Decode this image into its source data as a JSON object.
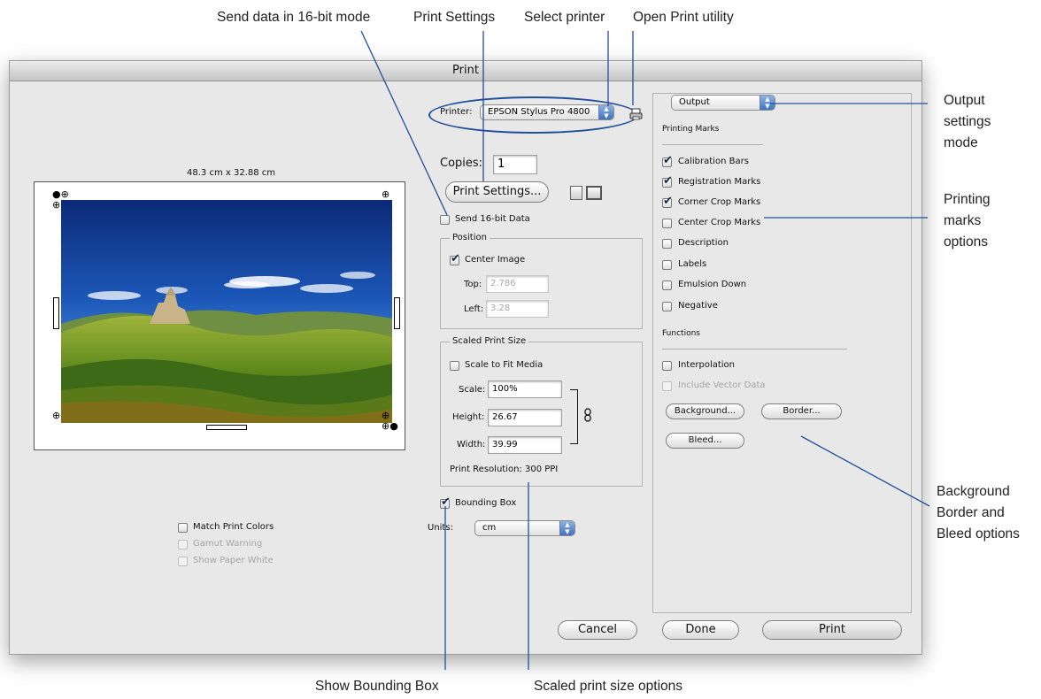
{
  "annotations": {
    "send_16bit": "Send data in 16-bit mode",
    "print_settings": "Print Settings",
    "select_printer": "Select printer",
    "open_print_utility": "Open Print utility",
    "output_settings_mode": [
      "Output",
      "settings",
      "mode"
    ],
    "printing_marks_options": [
      "Printing",
      "marks",
      "options"
    ],
    "background_border_bleed": [
      "Background",
      "Border and",
      "Bleed options"
    ],
    "show_bounding_box": "Show Bounding Box",
    "scaled_print_size_options": "Scaled print size options"
  },
  "dialog": {
    "title": "Print",
    "left": {
      "paper_size": "48.3 cm x 32.88 cm",
      "match_print_colors": {
        "label": "Match Print Colors",
        "checked": false
      },
      "gamut_warning": {
        "label": "Gamut Warning",
        "checked": false,
        "disabled": true
      },
      "show_paper_white": {
        "label": "Show Paper White",
        "checked": false,
        "disabled": true
      }
    },
    "middle": {
      "printer_label": "Printer:",
      "printer_value": "EPSON Stylus Pro 4800",
      "copies_label": "Copies:",
      "copies_value": "1",
      "print_settings_button": "Print Settings...",
      "send_16bit": {
        "label": "Send 16-bit Data",
        "checked": false
      },
      "position": {
        "title": "Position",
        "center_image": {
          "label": "Center Image",
          "checked": true
        },
        "top_label": "Top:",
        "top_value": "2.786",
        "left_label": "Left:",
        "left_value": "3.28"
      },
      "scaled": {
        "title": "Scaled Print Size",
        "scale_to_fit": {
          "label": "Scale to Fit Media",
          "checked": false
        },
        "scale_label": "Scale:",
        "scale_value": "100%",
        "height_label": "Height:",
        "height_value": "26.67",
        "width_label": "Width:",
        "width_value": "39.99",
        "resolution": "Print Resolution: 300 PPI"
      },
      "bounding_box": {
        "label": "Bounding Box",
        "checked": true
      },
      "units_label": "Units:",
      "units_value": "cm"
    },
    "right": {
      "mode_value": "Output",
      "printing_marks_title": "Printing Marks",
      "marks": [
        {
          "label": "Calibration Bars",
          "checked": true,
          "disabled": false
        },
        {
          "label": "Registration Marks",
          "checked": true,
          "disabled": false
        },
        {
          "label": "Corner Crop Marks",
          "checked": true,
          "disabled": false
        },
        {
          "label": "Center Crop Marks",
          "checked": false,
          "disabled": false
        },
        {
          "label": "Description",
          "checked": false,
          "disabled": false
        },
        {
          "label": "Labels",
          "checked": false,
          "disabled": false
        },
        {
          "label": "Emulsion Down",
          "checked": false,
          "disabled": false
        },
        {
          "label": "Negative",
          "checked": false,
          "disabled": false
        }
      ],
      "functions_title": "Functions",
      "interpolation": {
        "label": "Interpolation",
        "checked": false
      },
      "include_vector": {
        "label": "Include Vector Data",
        "checked": false,
        "disabled": true
      },
      "background_button": "Background...",
      "border_button": "Border...",
      "bleed_button": "Bleed..."
    },
    "buttons": {
      "cancel": "Cancel",
      "done": "Done",
      "print": "Print"
    }
  },
  "colors": {
    "callout_line": "#1f4f9a",
    "printer_highlight": "#1f4f9a"
  },
  "icons": [
    "print-utility-icon",
    "link-chain-icon",
    "page-portrait-icon",
    "page-landscape-icon",
    "popup-arrows-icon",
    "registration-mark-icon",
    "checkmark-icon"
  ]
}
